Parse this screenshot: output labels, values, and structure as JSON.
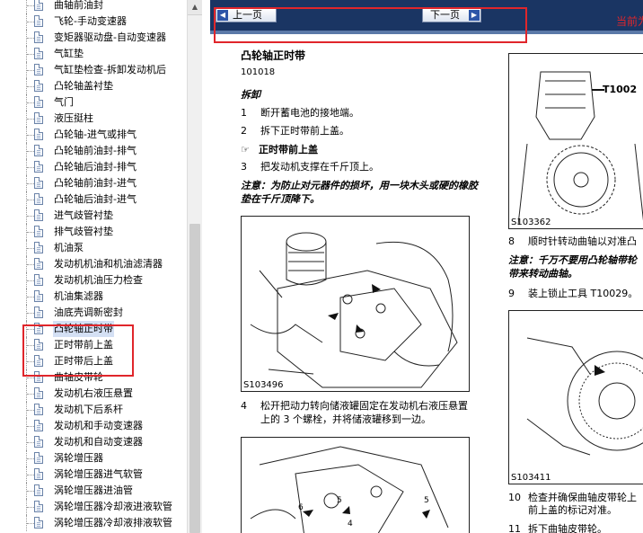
{
  "tree": {
    "items": [
      {
        "label": "曲轴前油封"
      },
      {
        "label": "飞轮-手动变速器"
      },
      {
        "label": "变矩器驱动盘-自动变速器"
      },
      {
        "label": "气缸垫"
      },
      {
        "label": "气缸垫检查-拆卸发动机后"
      },
      {
        "label": "凸轮轴盖衬垫"
      },
      {
        "label": "气门"
      },
      {
        "label": "液压挺柱"
      },
      {
        "label": "凸轮轴-进气或排气"
      },
      {
        "label": "凸轮轴前油封-排气"
      },
      {
        "label": "凸轮轴后油封-排气"
      },
      {
        "label": "凸轮轴前油封-进气"
      },
      {
        "label": "凸轮轴后油封-进气"
      },
      {
        "label": "进气歧管衬垫"
      },
      {
        "label": "排气歧管衬垫"
      },
      {
        "label": "机油泵"
      },
      {
        "label": "发动机机油和机油滤清器"
      },
      {
        "label": "发动机机油压力检查"
      },
      {
        "label": "机油集滤器"
      },
      {
        "label": "油底壳调新密封"
      },
      {
        "label": "凸轮轴正时带",
        "selected": true
      },
      {
        "label": "正时带前上盖"
      },
      {
        "label": "正时带后上盖"
      },
      {
        "label": "曲轴皮带轮"
      },
      {
        "label": "发动机右液压悬置"
      },
      {
        "label": "发动机下后系杆"
      },
      {
        "label": "发动机和手动变速器"
      },
      {
        "label": "发动机和自动变速器"
      },
      {
        "label": "涡轮增压器"
      },
      {
        "label": "涡轮增压器进气软管"
      },
      {
        "label": "涡轮增压器进油管"
      },
      {
        "label": "涡轮增压器冷却液进液软管"
      },
      {
        "label": "涡轮增压器冷却液排液软管"
      }
    ]
  },
  "nav": {
    "prev_label": "上一页",
    "next_label": "下一页",
    "page_info": "当前为"
  },
  "doc": {
    "title": "凸轮轴正时带",
    "code": "101018",
    "section": "拆卸",
    "step1": "断开蓄电池的接地端。",
    "step2": "拆下正时带前上盖。",
    "ref": "正时带前上盖",
    "step3": "把发动机支撑在千斤顶上。",
    "note1_line1": "注意：为防止对元器件的损坏，用一块木头或硬的橡胶",
    "note1_line2": "垫在千斤顶降下。",
    "fig1_caption": "S103496",
    "step4_line1": "松开把动力转向储液罐固定在发动机右液压悬置",
    "step4_line2": "上的 3 个螺栓，并将储液罐移到一边。",
    "fig_r1_caption": "S103362",
    "fig_r1_tool": "T1002",
    "step8": "顺时针转动曲轴以对准凸",
    "note2_line1": "注意：千万不要用凸轮轴带轮",
    "note2_line2": "带来转动曲轴。",
    "step9": "装上锁止工具 T10029。",
    "fig_r2_caption": "S103411",
    "step10_line1": "检查并确保曲轴皮带轮上",
    "step10_line2": "前上盖的标记对准。",
    "step11": "拆下曲轴皮带轮。",
    "fig1_labels": [
      "6",
      "5",
      "4",
      "5"
    ],
    "n1": "1",
    "n2": "2",
    "n3": "3",
    "n4": "4",
    "n8": "8",
    "n9": "9",
    "n10": "10",
    "n11": "11"
  },
  "colors": {
    "nav_bg": "#1a3563",
    "highlight": "#e0262b",
    "selected_bg": "#d4e0f4"
  }
}
